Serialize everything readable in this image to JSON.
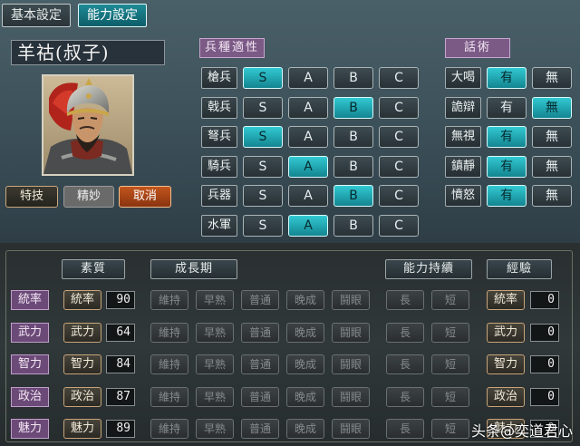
{
  "tabs": {
    "basic": "基本設定",
    "ability": "能力設定"
  },
  "officer": {
    "name": "羊祜(叔子)"
  },
  "portrait_buttons": {
    "tech": "特技",
    "skill": "精妙",
    "cancel": "取消"
  },
  "troop_header": "兵種適性",
  "speech_header": "話術",
  "grades": [
    "S",
    "A",
    "B",
    "C"
  ],
  "troops": [
    {
      "label": "槍兵",
      "selected": "S"
    },
    {
      "label": "戟兵",
      "selected": "B"
    },
    {
      "label": "弩兵",
      "selected": "S"
    },
    {
      "label": "騎兵",
      "selected": "A"
    },
    {
      "label": "兵器",
      "selected": "B"
    },
    {
      "label": "水軍",
      "selected": "A"
    }
  ],
  "speech_options": {
    "yes": "有",
    "no": "無"
  },
  "speech": [
    {
      "label": "大喝",
      "selected": "有"
    },
    {
      "label": "詭辯",
      "selected": "無"
    },
    {
      "label": "無視",
      "selected": "有"
    },
    {
      "label": "鎮靜",
      "selected": "有"
    },
    {
      "label": "憤怒",
      "selected": "有"
    }
  ],
  "bottom_headers": {
    "quality": "素質",
    "growth": "成長期",
    "persist": "能力持續",
    "exp": "經驗"
  },
  "growth_options": [
    "維持",
    "早熟",
    "普通",
    "晚成",
    "鬪眼"
  ],
  "persist_options": [
    "長",
    "短"
  ],
  "stats": [
    {
      "label": "統率",
      "value": "90",
      "exp": "0"
    },
    {
      "label": "武力",
      "value": "64",
      "exp": "0"
    },
    {
      "label": "智力",
      "value": "84",
      "exp": "0"
    },
    {
      "label": "政治",
      "value": "87",
      "exp": "0"
    },
    {
      "label": "魅力",
      "value": "89",
      "exp": "0"
    }
  ],
  "watermark": "头条@奕道君心",
  "colors": {
    "selected": "#32c9d2",
    "purple": "#7b5a86",
    "cancel": "#c2561c"
  }
}
